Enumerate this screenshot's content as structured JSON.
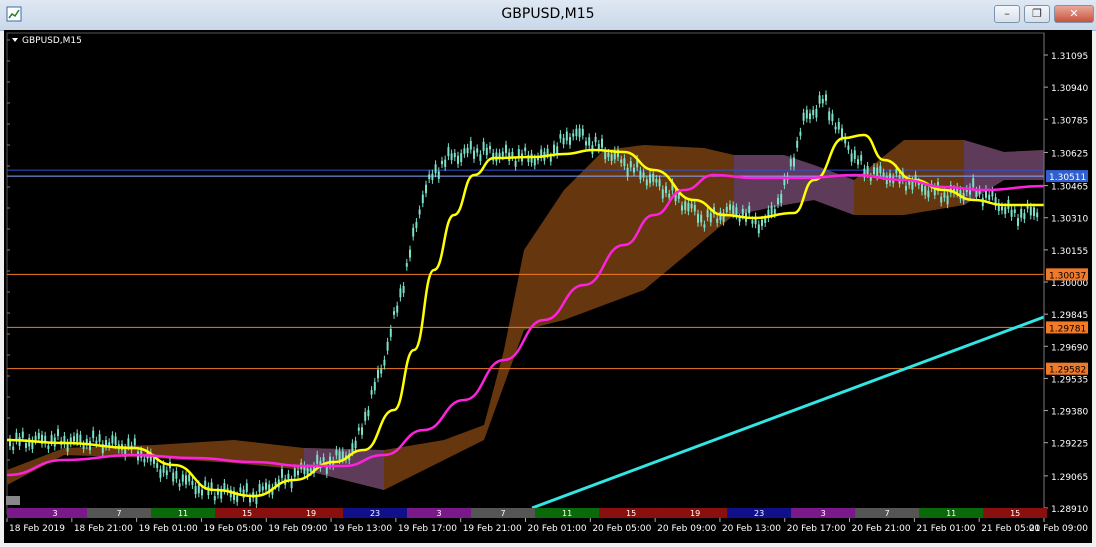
{
  "window": {
    "title": "GBPUSD,M15",
    "minimize_glyph": "–",
    "restore_glyph": "❐",
    "close_glyph": "✕"
  },
  "chart_label": "GBPUSD,M15",
  "price_ticks": [
    "1.31095",
    "1.30940",
    "1.30785",
    "1.30625",
    "1.30465",
    "1.30310",
    "1.30155",
    "1.30000",
    "1.29845",
    "1.29690",
    "1.29535",
    "1.29380",
    "1.29225",
    "1.29065",
    "1.28910"
  ],
  "current_price": "1.30511",
  "hlines": [
    {
      "price": 1.30037,
      "label": "1.30037"
    },
    {
      "price": 1.29781,
      "label": "1.29781"
    },
    {
      "price": 1.29582,
      "label": "1.29582"
    }
  ],
  "time_labels": [
    "18 Feb 2019",
    "18 Feb 21:00",
    "19 Feb 01:00",
    "19 Feb 05:00",
    "19 Feb 09:00",
    "19 Feb 13:00",
    "19 Feb 17:00",
    "19 Feb 21:00",
    "20 Feb 01:00",
    "20 Feb 05:00",
    "20 Feb 09:00",
    "20 Feb 13:00",
    "20 Feb 17:00",
    "20 Feb 21:00",
    "21 Feb 01:00",
    "21 Feb 05:00",
    "21 Feb 09:00"
  ],
  "session_hours": [
    "3",
    "7",
    "11",
    "15",
    "19",
    "23",
    "3",
    "7",
    "11",
    "15",
    "19",
    "23",
    "3",
    "7",
    "11",
    "15"
  ],
  "colors": {
    "background": "#000000",
    "candles": "#7de0c8",
    "fast_ma": "#ffff00",
    "mid_ma": "#ff22dd",
    "slow_ma": "#33e6e6",
    "cloud_bear": "#6b3a10",
    "cloud_bull": "#5d3c62",
    "hline": "#f07a28"
  }
}
